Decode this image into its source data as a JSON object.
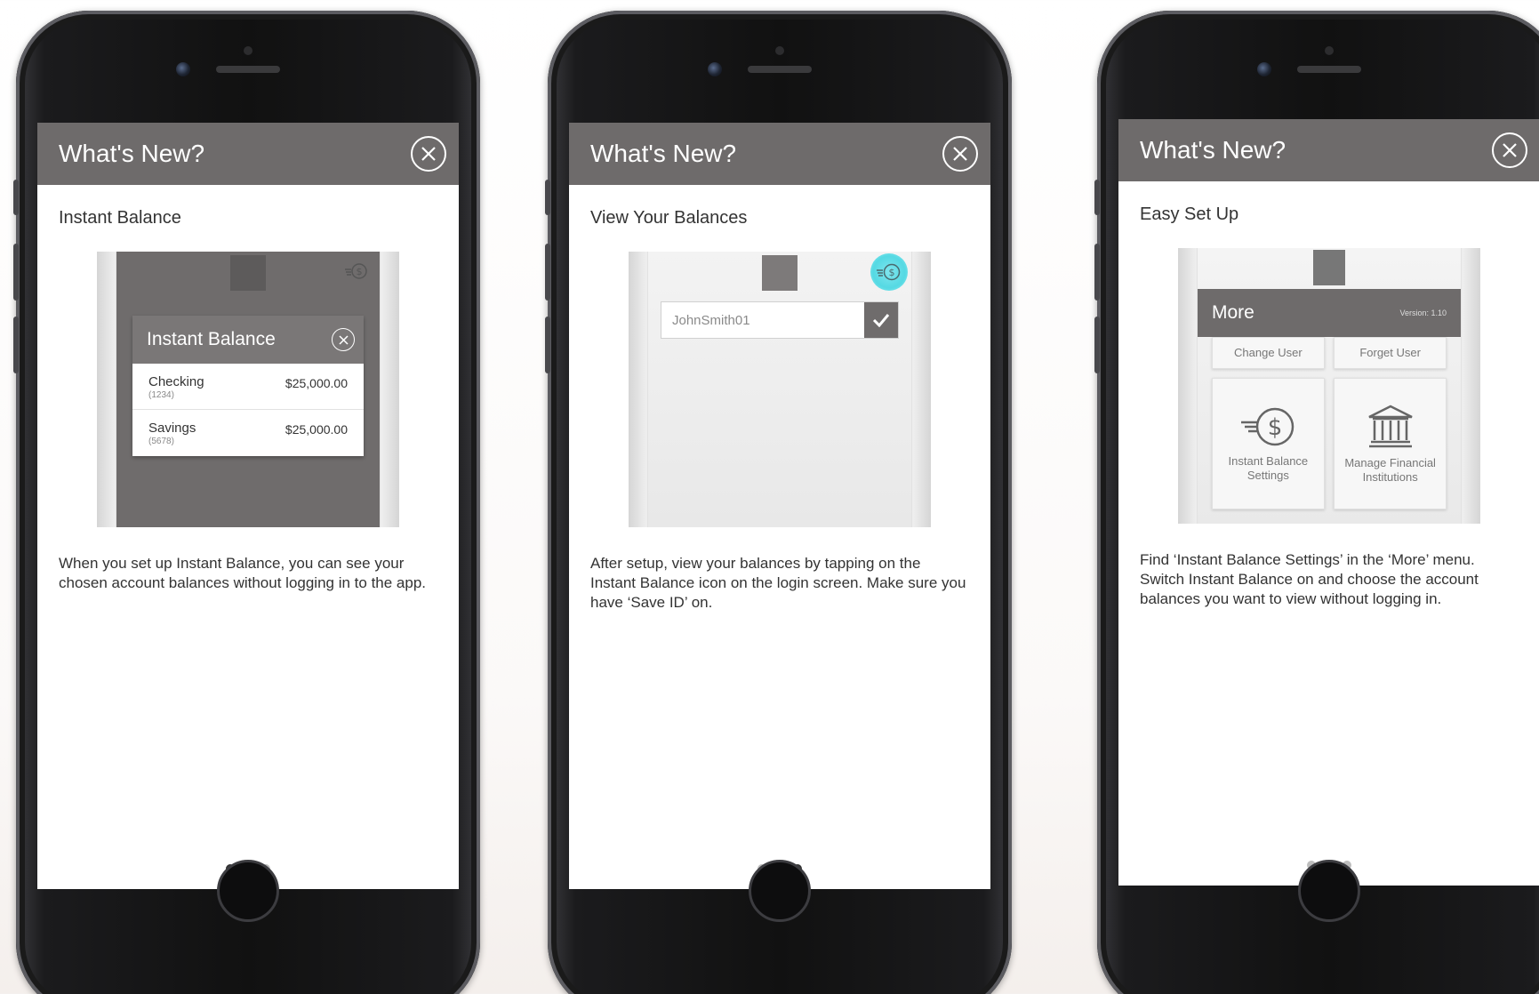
{
  "panels": [
    {
      "header_title": "What's New?",
      "subtitle": "Instant Balance",
      "description": "When you set up Instant Balance, you can see your chosen account balances without logging in to the app.",
      "illustration": {
        "modal_title": "Instant Balance",
        "accounts": [
          {
            "name": "Checking",
            "number": "(1234)",
            "balance": "$25,000.00"
          },
          {
            "name": "Savings",
            "number": "(5678)",
            "balance": "$25,000.00"
          }
        ]
      },
      "pager_active": 0
    },
    {
      "header_title": "What's New?",
      "subtitle": "View Your Balances",
      "description": "After setup, view your balances by tapping on the Instant Balance icon on the login screen. Make sure you have ‘Save ID’ on.",
      "illustration": {
        "username_value": "JohnSmith01"
      },
      "pager_active": 2
    },
    {
      "header_title": "What's New?",
      "subtitle": "Easy Set Up",
      "description": "Find ‘Instant Balance Settings’ in the ‘More’ menu. Switch Instant Balance on and choose the account balances you want to view without logging in.",
      "illustration": {
        "menu_title": "More",
        "version": "Version: 1.10",
        "tiles": [
          "Change User",
          "Forget User",
          "Instant Balance Settings",
          "Manage Financial Institutions"
        ]
      },
      "pager_active": 1
    }
  ],
  "colors": {
    "header_bg": "#6e6b6b",
    "accent_cyan": "#55d9e3",
    "pager_active": "#333333",
    "pager_inactive": "#bdbdbd"
  },
  "icons": [
    "close-icon",
    "instant-balance-icon",
    "checkmark-icon",
    "bank-icon"
  ]
}
